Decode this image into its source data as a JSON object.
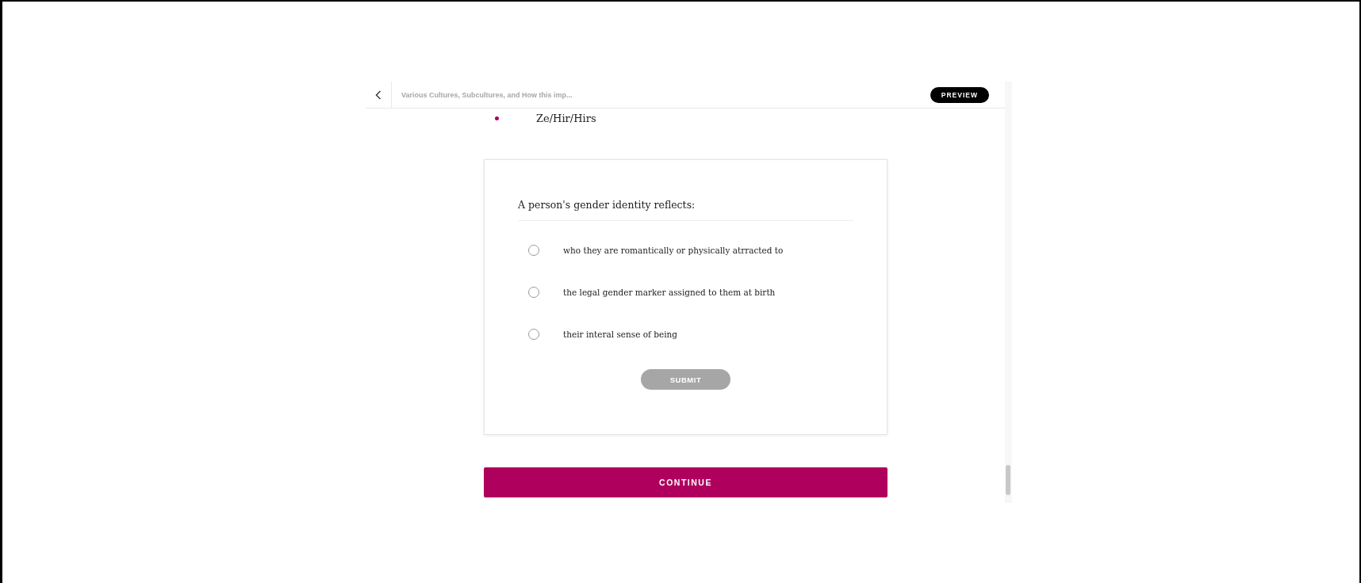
{
  "header": {
    "title": "Various Cultures, Subcultures, and How this imp...",
    "badge": "PREVIEW"
  },
  "list_items": [
    "Ze/Hir/Hirs"
  ],
  "question": {
    "prompt": "A person's gender identity reflects:",
    "options": [
      {
        "label": "who they are romantically or physically atrracted to",
        "selected": false
      },
      {
        "label": "the legal gender marker assigned to them at birth",
        "selected": false
      },
      {
        "label": "their interal sense of being",
        "selected": false
      }
    ],
    "submit": {
      "label": "SUBMIT",
      "disabled": true
    }
  },
  "continue_button": "CONTINUE"
}
